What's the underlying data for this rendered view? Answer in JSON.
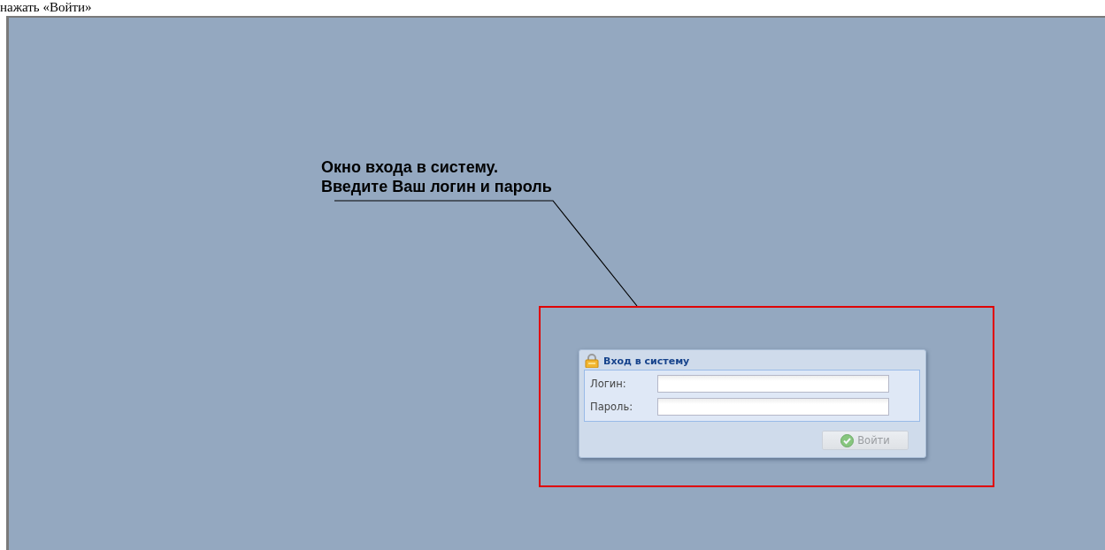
{
  "document_text": "нажать «Войти»",
  "annotation": {
    "lines": [
      "Окно входа в систему.",
      "Введите Ваш логин и пароль"
    ]
  },
  "login_dialog": {
    "title": "Вход в систему",
    "fields": [
      {
        "label": "Логин:"
      },
      {
        "label": "Пароль:"
      }
    ],
    "button": {
      "label": "Войти",
      "disabled": true
    }
  }
}
